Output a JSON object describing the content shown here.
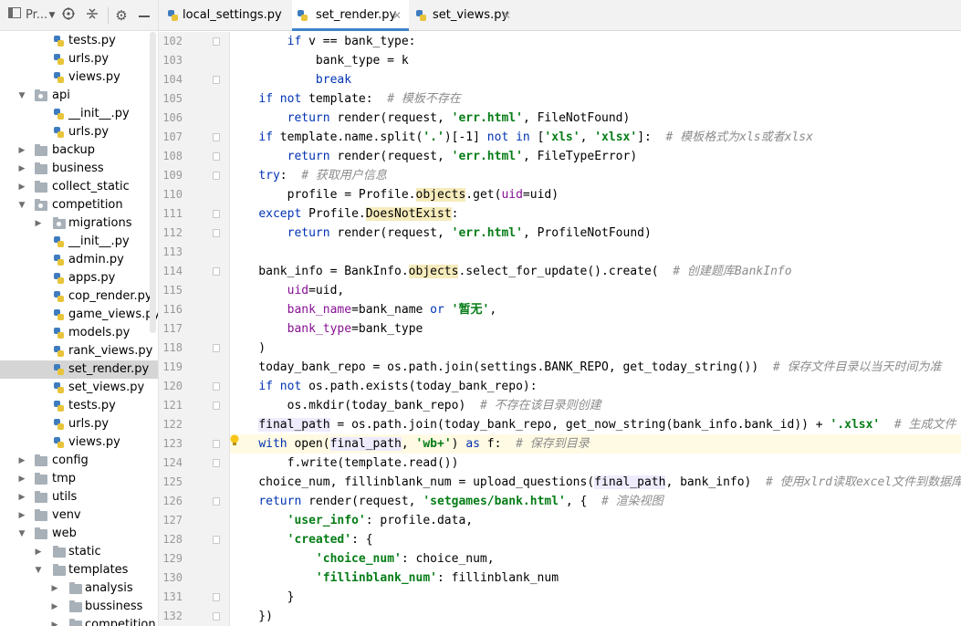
{
  "project_panel": {
    "title": "Pr...",
    "tree": [
      {
        "label": "tests.py",
        "type": "py",
        "depth": 3
      },
      {
        "label": "urls.py",
        "type": "py",
        "depth": 3
      },
      {
        "label": "views.py",
        "type": "py",
        "depth": 3
      },
      {
        "label": "api",
        "type": "pkg",
        "depth": 1,
        "expanded": true
      },
      {
        "label": "__init__.py",
        "type": "py",
        "depth": 3
      },
      {
        "label": "urls.py",
        "type": "py",
        "depth": 3
      },
      {
        "label": "backup",
        "type": "folder",
        "depth": 1,
        "expanded": false
      },
      {
        "label": "business",
        "type": "folder",
        "depth": 1,
        "expanded": false
      },
      {
        "label": "collect_static",
        "type": "folder",
        "depth": 1,
        "expanded": false
      },
      {
        "label": "competition",
        "type": "pkg",
        "depth": 1,
        "expanded": true
      },
      {
        "label": "migrations",
        "type": "pkg",
        "depth": 2,
        "expanded": false
      },
      {
        "label": "__init__.py",
        "type": "py",
        "depth": 3
      },
      {
        "label": "admin.py",
        "type": "py",
        "depth": 3
      },
      {
        "label": "apps.py",
        "type": "py",
        "depth": 3
      },
      {
        "label": "cop_render.py",
        "type": "py",
        "depth": 3
      },
      {
        "label": "game_views.py",
        "type": "py",
        "depth": 3
      },
      {
        "label": "models.py",
        "type": "py",
        "depth": 3
      },
      {
        "label": "rank_views.py",
        "type": "py",
        "depth": 3
      },
      {
        "label": "set_render.py",
        "type": "py",
        "depth": 3,
        "selected": true
      },
      {
        "label": "set_views.py",
        "type": "py",
        "depth": 3
      },
      {
        "label": "tests.py",
        "type": "py",
        "depth": 3
      },
      {
        "label": "urls.py",
        "type": "py",
        "depth": 3
      },
      {
        "label": "views.py",
        "type": "py",
        "depth": 3
      },
      {
        "label": "config",
        "type": "folder",
        "depth": 1,
        "expanded": false
      },
      {
        "label": "tmp",
        "type": "folder",
        "depth": 1,
        "expanded": false
      },
      {
        "label": "utils",
        "type": "folder",
        "depth": 1,
        "expanded": false
      },
      {
        "label": "venv",
        "type": "folder",
        "depth": 1,
        "expanded": false
      },
      {
        "label": "web",
        "type": "folder",
        "depth": 1,
        "expanded": true
      },
      {
        "label": "static",
        "type": "folder",
        "depth": 2,
        "expanded": false
      },
      {
        "label": "templates",
        "type": "folder",
        "depth": 2,
        "expanded": true
      },
      {
        "label": "analysis",
        "type": "folder",
        "depth": 3,
        "expanded": false
      },
      {
        "label": "bussiness",
        "type": "folder",
        "depth": 3,
        "expanded": false
      },
      {
        "label": "competition",
        "type": "folder",
        "depth": 3,
        "expanded": false
      }
    ]
  },
  "tabs": [
    {
      "label": "local_settings.py",
      "active": false
    },
    {
      "label": "set_render.py",
      "active": true
    },
    {
      "label": "set_views.py",
      "active": false
    }
  ],
  "editor": {
    "current_line": 123,
    "lines": [
      {
        "n": 102,
        "fold": true,
        "segs": [
          [
            "        ",
            ""
          ],
          [
            "if",
            "kw"
          ],
          [
            " v == bank_type:",
            ""
          ]
        ]
      },
      {
        "n": 103,
        "segs": [
          [
            "            bank_type = k",
            ""
          ]
        ]
      },
      {
        "n": 104,
        "fold": true,
        "segs": [
          [
            "            ",
            ""
          ],
          [
            "break",
            "kw"
          ]
        ]
      },
      {
        "n": 105,
        "segs": [
          [
            "    ",
            ""
          ],
          [
            "if not",
            "kw"
          ],
          [
            " template:  ",
            ""
          ],
          [
            "# 模板不存在",
            "cm"
          ]
        ]
      },
      {
        "n": 106,
        "segs": [
          [
            "        ",
            ""
          ],
          [
            "return",
            "kw"
          ],
          [
            " render(request, ",
            ""
          ],
          [
            "'err.html'",
            "str"
          ],
          [
            ", FileNotFound)",
            ""
          ]
        ]
      },
      {
        "n": 107,
        "fold": true,
        "segs": [
          [
            "    ",
            ""
          ],
          [
            "if",
            "kw"
          ],
          [
            " template.name.split(",
            ""
          ],
          [
            "'.'",
            "str"
          ],
          [
            ")[-1] ",
            ""
          ],
          [
            "not in",
            "kw"
          ],
          [
            " [",
            ""
          ],
          [
            "'xls'",
            "str"
          ],
          [
            ", ",
            ""
          ],
          [
            "'xlsx'",
            "str"
          ],
          [
            "]:  ",
            ""
          ],
          [
            "# 模板格式为xls或者xlsx",
            "cm"
          ]
        ]
      },
      {
        "n": 108,
        "fold": true,
        "segs": [
          [
            "        ",
            ""
          ],
          [
            "return",
            "kw"
          ],
          [
            " render(request, ",
            ""
          ],
          [
            "'err.html'",
            "str"
          ],
          [
            ", FileTypeError)",
            ""
          ]
        ]
      },
      {
        "n": 109,
        "fold": true,
        "segs": [
          [
            "    ",
            ""
          ],
          [
            "try",
            "kw"
          ],
          [
            ":  ",
            ""
          ],
          [
            "# 获取用户信息",
            "cm"
          ]
        ]
      },
      {
        "n": 110,
        "segs": [
          [
            "        profile = Profile.",
            ""
          ],
          [
            "objects",
            "hl"
          ],
          [
            ".get(",
            ""
          ],
          [
            "uid",
            "param"
          ],
          [
            "=uid)",
            ""
          ]
        ]
      },
      {
        "n": 111,
        "fold": true,
        "segs": [
          [
            "    ",
            ""
          ],
          [
            "except",
            "kw"
          ],
          [
            " Profile.",
            ""
          ],
          [
            "DoesNotExist",
            "hl"
          ],
          [
            ":",
            ""
          ]
        ]
      },
      {
        "n": 112,
        "fold": true,
        "segs": [
          [
            "        ",
            ""
          ],
          [
            "return",
            "kw"
          ],
          [
            " render(request, ",
            ""
          ],
          [
            "'err.html'",
            "str"
          ],
          [
            ", ProfileNotFound)",
            ""
          ]
        ]
      },
      {
        "n": 113,
        "segs": [
          [
            "",
            ""
          ]
        ]
      },
      {
        "n": 114,
        "fold": true,
        "segs": [
          [
            "    bank_info = BankInfo.",
            ""
          ],
          [
            "objects",
            "hl"
          ],
          [
            ".select_for_update().create(  ",
            ""
          ],
          [
            "# 创建题库BankInfo",
            "cm"
          ]
        ]
      },
      {
        "n": 115,
        "segs": [
          [
            "        ",
            ""
          ],
          [
            "uid",
            "param"
          ],
          [
            "=uid,",
            ""
          ]
        ]
      },
      {
        "n": 116,
        "segs": [
          [
            "        ",
            ""
          ],
          [
            "bank_name",
            "param"
          ],
          [
            "=bank_name ",
            ""
          ],
          [
            "or",
            "kw"
          ],
          [
            " ",
            ""
          ],
          [
            "'暂无'",
            "str"
          ],
          [
            ",",
            ""
          ]
        ]
      },
      {
        "n": 117,
        "segs": [
          [
            "        ",
            ""
          ],
          [
            "bank_type",
            "param"
          ],
          [
            "=bank_type",
            ""
          ]
        ]
      },
      {
        "n": 118,
        "fold": true,
        "segs": [
          [
            "    )",
            ""
          ]
        ]
      },
      {
        "n": 119,
        "segs": [
          [
            "    today_bank_repo = os.path.join(settings.BANK_REPO, get_today_string())  ",
            ""
          ],
          [
            "# 保存文件目录以当天时间为准",
            "cm"
          ]
        ]
      },
      {
        "n": 120,
        "fold": true,
        "segs": [
          [
            "    ",
            ""
          ],
          [
            "if not",
            "kw"
          ],
          [
            " os.path.exists(today_bank_repo):",
            ""
          ]
        ]
      },
      {
        "n": 121,
        "fold": true,
        "segs": [
          [
            "        os.mkdir(today_bank_repo)  ",
            ""
          ],
          [
            "# 不存在该目录则创建",
            "cm"
          ]
        ]
      },
      {
        "n": 122,
        "segs": [
          [
            "    ",
            ""
          ],
          [
            "final_path",
            "ref"
          ],
          [
            " = os.path.join(today_bank_repo, get_now_string(bank_info.bank_id)) + ",
            ""
          ],
          [
            "'.xlsx'",
            "str"
          ],
          [
            "  ",
            ""
          ],
          [
            "# 生成文件",
            "cm"
          ]
        ]
      },
      {
        "n": 123,
        "fold": true,
        "segs": [
          [
            "    ",
            ""
          ],
          [
            "with",
            "kw"
          ],
          [
            " open(",
            ""
          ],
          [
            "final_pat",
            "ref"
          ],
          [
            "CARET",
            ""
          ],
          [
            "h",
            "ref"
          ],
          [
            ", ",
            ""
          ],
          [
            "'wb+'",
            "str"
          ],
          [
            ") ",
            ""
          ],
          [
            "as",
            "kw"
          ],
          [
            " f:  ",
            ""
          ],
          [
            "# 保存到目录",
            "cm"
          ]
        ]
      },
      {
        "n": 124,
        "fold": true,
        "segs": [
          [
            "        f.write(template.read())",
            ""
          ]
        ]
      },
      {
        "n": 125,
        "segs": [
          [
            "    choice_num, fillinblank_num = upload_questions(",
            ""
          ],
          [
            "final_path",
            "ref"
          ],
          [
            ", bank_info)  ",
            ""
          ],
          [
            "# 使用xlrd读取excel文件到数据库",
            "cm"
          ]
        ]
      },
      {
        "n": 126,
        "fold": true,
        "segs": [
          [
            "    ",
            ""
          ],
          [
            "return",
            "kw"
          ],
          [
            " render(request, ",
            ""
          ],
          [
            "'setgames/bank.html'",
            "str"
          ],
          [
            ", {  ",
            ""
          ],
          [
            "# 渲染视图",
            "cm"
          ]
        ]
      },
      {
        "n": 127,
        "segs": [
          [
            "        ",
            ""
          ],
          [
            "'user_info'",
            "str"
          ],
          [
            ": profile.data,",
            ""
          ]
        ]
      },
      {
        "n": 128,
        "fold": true,
        "segs": [
          [
            "        ",
            ""
          ],
          [
            "'created'",
            "str"
          ],
          [
            ": {",
            ""
          ]
        ]
      },
      {
        "n": 129,
        "segs": [
          [
            "            ",
            ""
          ],
          [
            "'choice_num'",
            "str"
          ],
          [
            ": choice_num,",
            ""
          ]
        ]
      },
      {
        "n": 130,
        "segs": [
          [
            "            ",
            ""
          ],
          [
            "'fillinblank_num'",
            "str"
          ],
          [
            ": fillinblank_num",
            ""
          ]
        ]
      },
      {
        "n": 131,
        "fold": true,
        "segs": [
          [
            "        }",
            ""
          ]
        ]
      },
      {
        "n": 132,
        "fold": true,
        "segs": [
          [
            "    })",
            ""
          ]
        ]
      }
    ]
  }
}
